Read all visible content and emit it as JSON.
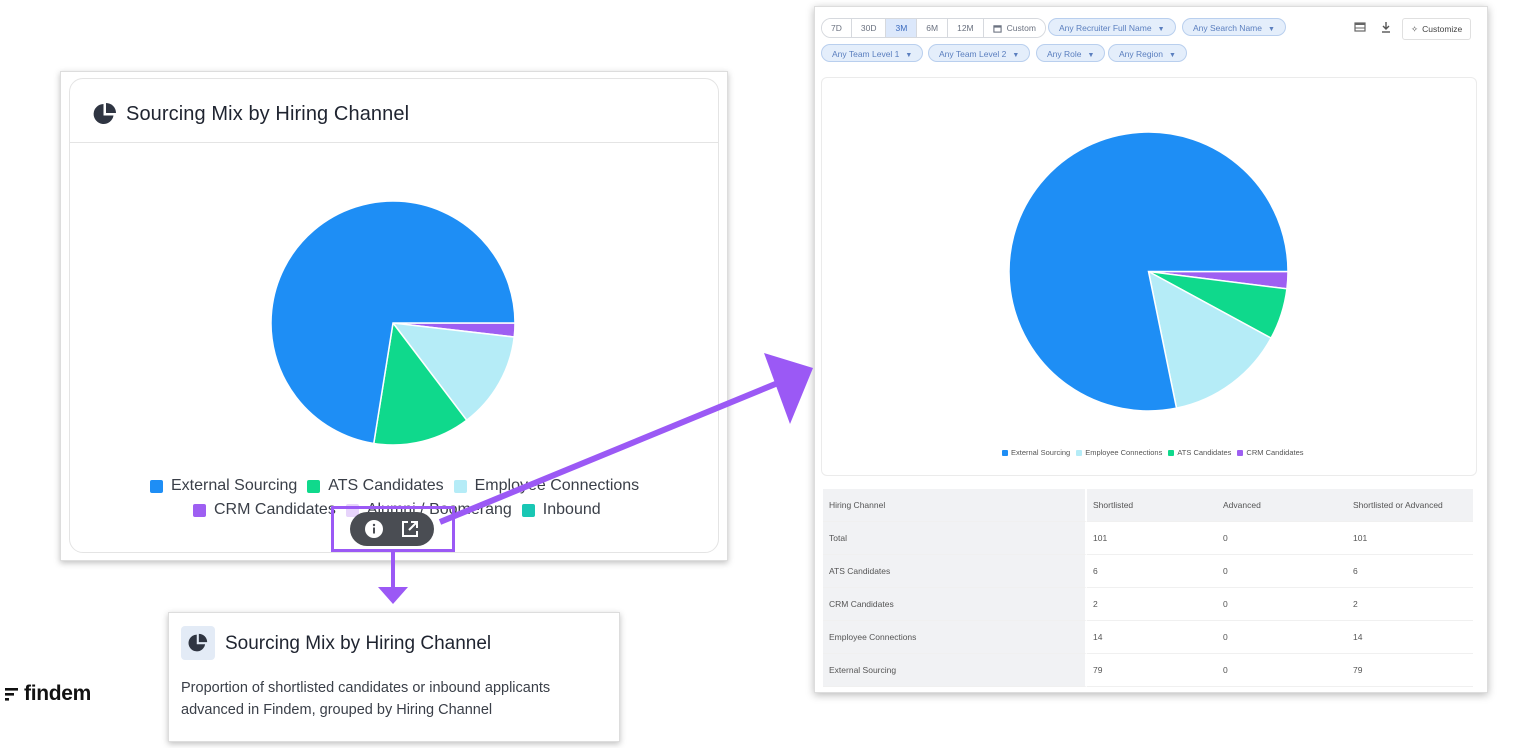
{
  "widget": {
    "title": "Sourcing Mix by Hiring Channel",
    "legend": {
      "row1": [
        "External Sourcing",
        "ATS Candidates",
        "Employee Connections"
      ],
      "row2": [
        "CRM Candidates",
        "Alumni / Boomerang",
        "Inbound"
      ]
    },
    "toolbar": {
      "info_icon": "info-icon",
      "open_icon": "open-external-icon"
    }
  },
  "info_popup": {
    "title": "Sourcing Mix by Hiring Channel",
    "description": "Proportion of shortlisted candidates or inbound applicants advanced in Findem, grouped by Hiring Channel"
  },
  "logo": {
    "text": "findem"
  },
  "expanded": {
    "ranges": [
      "7D",
      "30D",
      "3M",
      "6M",
      "12M"
    ],
    "active_range": "3M",
    "custom_label": "Custom",
    "filters_row1": [
      "Any Recruiter Full Name",
      "Any Search Name"
    ],
    "filters_row2": [
      "Any Team Level 1",
      "Any Team Level 2",
      "Any Role",
      "Any Region"
    ],
    "customize_label": "Customize",
    "legend": [
      "External Sourcing",
      "Employee Connections",
      "ATS Candidates",
      "CRM Candidates"
    ],
    "table": {
      "headers": [
        "Hiring Channel",
        "Shortlisted",
        "Advanced",
        "Shortlisted or Advanced"
      ],
      "rows": [
        [
          "Total",
          "101",
          "0",
          "101"
        ],
        [
          "ATS Candidates",
          "6",
          "0",
          "6"
        ],
        [
          "CRM Candidates",
          "2",
          "0",
          "2"
        ],
        [
          "Employee Connections",
          "14",
          "0",
          "14"
        ],
        [
          "External Sourcing",
          "79",
          "0",
          "79"
        ]
      ]
    }
  },
  "colors": {
    "external": "#1e8ef5",
    "ats": "#0fd98c",
    "employee": "#b5ecf7",
    "crm": "#9e5ff2",
    "alumni": "#e7d4fb",
    "inbound": "#19c7b4",
    "highlight": "#9b59f5"
  },
  "chart_data": [
    {
      "type": "pie",
      "title": "Sourcing Mix by Hiring Channel",
      "categories": [
        "External Sourcing",
        "ATS Candidates",
        "Employee Connections",
        "CRM Candidates"
      ],
      "values": [
        79,
        14,
        14,
        2
      ]
    },
    {
      "type": "pie",
      "categories": [
        "External Sourcing",
        "Employee Connections",
        "ATS Candidates",
        "CRM Candidates"
      ],
      "values": [
        79,
        14,
        6,
        2
      ]
    }
  ]
}
